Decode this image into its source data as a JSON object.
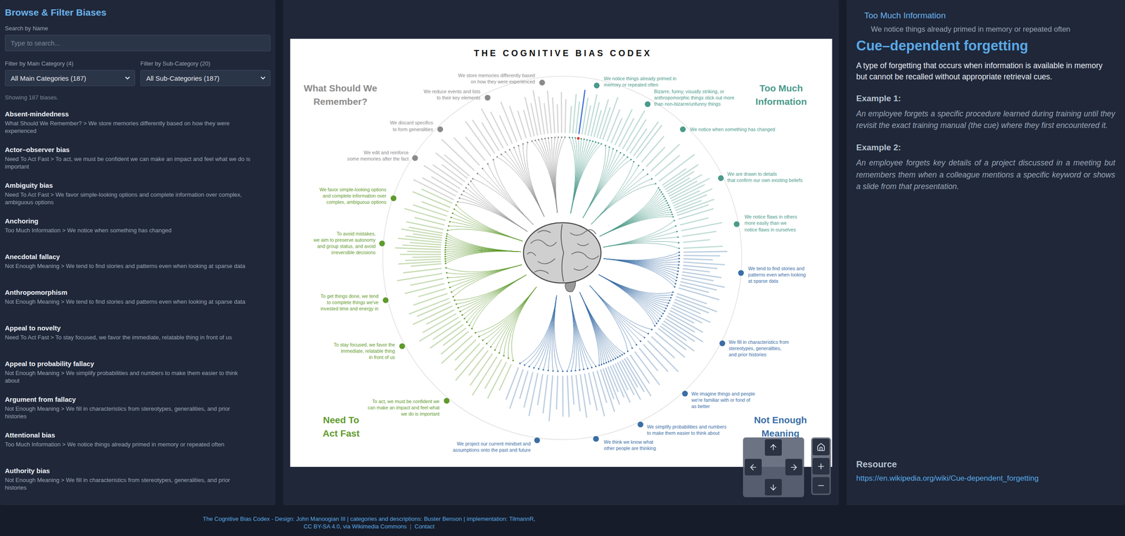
{
  "left_panel": {
    "title": "Browse & Filter Biases",
    "search": {
      "label": "Search by Name",
      "placeholder": "Type to search..."
    },
    "filters": [
      {
        "label": "Filter by Main Category (4)",
        "value": "All Main Categories (187)"
      },
      {
        "label": "Filter by Sub-Category (20)",
        "value": "All Sub-Categories (187)"
      }
    ],
    "count": "Showing 187 biases.",
    "items": [
      {
        "name": "Absent-mindedness",
        "path": "What Should We Remember? > We store memories differently based on how they were experienced"
      },
      {
        "name": "Actor–observer bias",
        "path": "Need To Act Fast > To act, we must be confident we can make an impact and feel what we do is important"
      },
      {
        "name": "Ambiguity bias",
        "path": "Need To Act Fast > We favor simple-looking options and complete information over complex, ambiguous options"
      },
      {
        "name": "Anchoring",
        "path": "Too Much Information > We notice when something has changed"
      },
      {
        "name": "Anecdotal fallacy",
        "path": "Not Enough Meaning > We tend to find stories and patterns even when looking at sparse data"
      },
      {
        "name": "Anthropomorphism",
        "path": "Not Enough Meaning > We tend to find stories and patterns even when looking at sparse data"
      },
      {
        "name": "Appeal to novelty",
        "path": "Need To Act Fast > To stay focused, we favor the immediate, relatable thing in front of us"
      },
      {
        "name": "Appeal to probability fallacy",
        "path": "Not Enough Meaning > We simplify probabilities and numbers to make them easier to think about"
      },
      {
        "name": "Argument from fallacy",
        "path": "Not Enough Meaning > We fill in characteristics from stereotypes, generalities, and prior histories"
      },
      {
        "name": "Attentional bias",
        "path": "Too Much Information > We notice things already primed in memory or repeated often"
      },
      {
        "name": "Authority bias",
        "path": "Not Enough Meaning > We fill in characteristics from stereotypes, generalities, and prior histories"
      }
    ]
  },
  "codex": {
    "title": "THE COGNITIVE BIAS CODEX",
    "categories": [
      {
        "lines": [
          "Too Much",
          "Information"
        ],
        "color": "#4b9a8a",
        "subcategories": [
          {
            "lines": [
              "We notice things already primed in",
              "memory or repeated often"
            ],
            "biases": 12,
            "selected_leaf": 3
          },
          {
            "lines": [
              "Bizarre, funny, visually striking, or",
              "anthropomorphic things stick out more",
              "than non-bizarre/unfunny things"
            ],
            "biases": 8,
            "selected_leaf": null
          },
          {
            "lines": [
              "We notice when something has changed"
            ],
            "biases": 6,
            "selected_leaf": null
          },
          {
            "lines": [
              "We are drawn to details",
              "that confirm our own existing beliefs"
            ],
            "biases": 14,
            "selected_leaf": null
          },
          {
            "lines": [
              "We notice flaws in others",
              "more easily than we",
              "notice flaws in ourselves"
            ],
            "biases": 6,
            "selected_leaf": null
          }
        ]
      },
      {
        "lines": [
          "Not Enough",
          "Meaning"
        ],
        "color": "#3a6ea5",
        "subcategories": [
          {
            "lines": [
              "We tend to find stories and",
              "patterns even when looking",
              "at sparse data"
            ],
            "biases": 12,
            "selected_leaf": null
          },
          {
            "lines": [
              "We fill in characteristics from",
              "stereotypes, generalities,",
              "and prior histories"
            ],
            "biases": 14,
            "selected_leaf": null
          },
          {
            "lines": [
              "We imagine things and people",
              "we're familiar with or fond of",
              "as better"
            ],
            "biases": 7,
            "selected_leaf": null
          },
          {
            "lines": [
              "We simplify probabilities and numbers",
              "to make them easier to think about"
            ],
            "biases": 12,
            "selected_leaf": null
          },
          {
            "lines": [
              "We think we know what",
              "other people are thinking"
            ],
            "biases": 8,
            "selected_leaf": null
          },
          {
            "lines": [
              "We project our current mindset and",
              "assumptions onto the past and future"
            ],
            "biases": 10,
            "selected_leaf": null
          }
        ]
      },
      {
        "lines": [
          "Need To",
          "Act Fast"
        ],
        "color": "#5f9a2c",
        "subcategories": [
          {
            "lines": [
              "To act, we must be confident we",
              "can make an impact and feel what",
              "we do is important"
            ],
            "biases": 10,
            "selected_leaf": null
          },
          {
            "lines": [
              "To stay focused, we favor the",
              "immediate, relatable thing",
              "in front of us"
            ],
            "biases": 9,
            "selected_leaf": null
          },
          {
            "lines": [
              "To get things done, we tend",
              "to complete things we've",
              "invested time and energy in"
            ],
            "biases": 7,
            "selected_leaf": null
          },
          {
            "lines": [
              "To avoid mistakes,",
              "we aim to preserve autonomy",
              "and group status, and avoid",
              "irreversible decisions"
            ],
            "biases": 14,
            "selected_leaf": null
          },
          {
            "lines": [
              "We favor simple-looking options",
              "and complete information over",
              "complex, ambiguous options"
            ],
            "biases": 7,
            "selected_leaf": null
          }
        ]
      },
      {
        "lines": [
          "What Should We",
          "Remember?"
        ],
        "color": "#8a8a8a",
        "subcategories": [
          {
            "lines": [
              "We edit and reinforce",
              "some memories after the fact"
            ],
            "biases": 7,
            "selected_leaf": null
          },
          {
            "lines": [
              "We discard specifics",
              "to form generalities"
            ],
            "biases": 5,
            "selected_leaf": null
          },
          {
            "lines": [
              "We reduce events and lists",
              "to their key elements"
            ],
            "biases": 8,
            "selected_leaf": null
          },
          {
            "lines": [
              "We store memories differently based",
              "on how they were experienced"
            ],
            "biases": 11,
            "selected_leaf": null
          }
        ]
      }
    ]
  },
  "detail": {
    "category": "Too Much Information",
    "subcategory": "We notice things already primed in memory or repeated often",
    "name": "Cue–dependent forgetting",
    "description": "A type of forgetting that occurs when information is available in memory but cannot be recalled without appropriate retrieval cues.",
    "examples": [
      {
        "label": "Example 1:",
        "text": "An employee forgets a specific procedure learned during training until they revisit the exact training manual (the cue) where they first encountered it."
      },
      {
        "label": "Example 2:",
        "text": "An employee forgets key details of a project discussed in a meeting but remembers them when a colleague mentions a specific keyword or shows a slide from that presentation."
      }
    ],
    "resource_label": "Resource",
    "resource_url": "https://en.wikipedia.org/wiki/Cue-dependent_forgetting"
  },
  "footer": {
    "credits": "The Cognitive Bias Codex - Design: John Manoogian III | categories and descriptions: Buster Benson | implementation: TilmannR,",
    "license": "CC BY-SA 4.0, via Wikimedia Commons",
    "separator": "|",
    "contact": "Contact"
  }
}
